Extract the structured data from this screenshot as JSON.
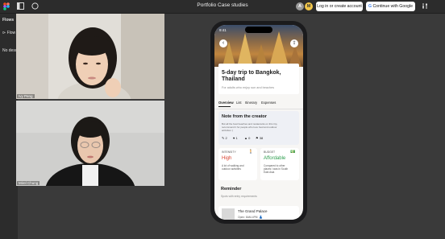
{
  "toolbar": {
    "title": "Portfolio Case studies",
    "avatar_a": "A",
    "avatar_m": "M",
    "login_label": "Log in or create account",
    "google_label": "Continue with Google"
  },
  "left_panel": {
    "heading": "Flows",
    "item_1": "Flow",
    "no_desc": "No desc"
  },
  "videos": {
    "person1_name": "Ivy Peng",
    "person2_name": "Mirel Chung"
  },
  "phone": {
    "time": "9:41",
    "trip_title_line1": "5-day trip to Bangkok,",
    "trip_title_line2": "Thailand",
    "subtitle": "For adults who enjoy sun and beaches",
    "tabs": [
      "Overview",
      "List",
      "Itinerary",
      "Expenses"
    ],
    "creator_heading": "Note from the creator",
    "creator_body_1": "But all the best beaches and restaurants on this trip,",
    "creator_body_2": "recommend it for people who love food and outdoor",
    "creator_body_3": "activities :)",
    "stats": [
      "2",
      "1",
      "0",
      "38"
    ],
    "intensity_label": "INTENSITY",
    "intensity_value": "High",
    "intensity_desc_1": "A lot of walking and",
    "intensity_desc_2": "outdoor activities",
    "budget_label": "BUDGET",
    "budget_value": "Affordable",
    "budget_desc_1": "Compared to other",
    "budget_desc_2": "places I was in South",
    "budget_desc_3": "East Asia",
    "reminder_heading": "Reminder",
    "reminder_sub": "Spots with entry requirements",
    "place_name": "The Grand Palace",
    "place_hours": "Open: 8AM-4PM"
  },
  "colors": {
    "intensity": "#d8412f",
    "budget": "#2e9e4f",
    "login_bg": "#ffffff",
    "accent_tab": "#1c1c1c"
  }
}
